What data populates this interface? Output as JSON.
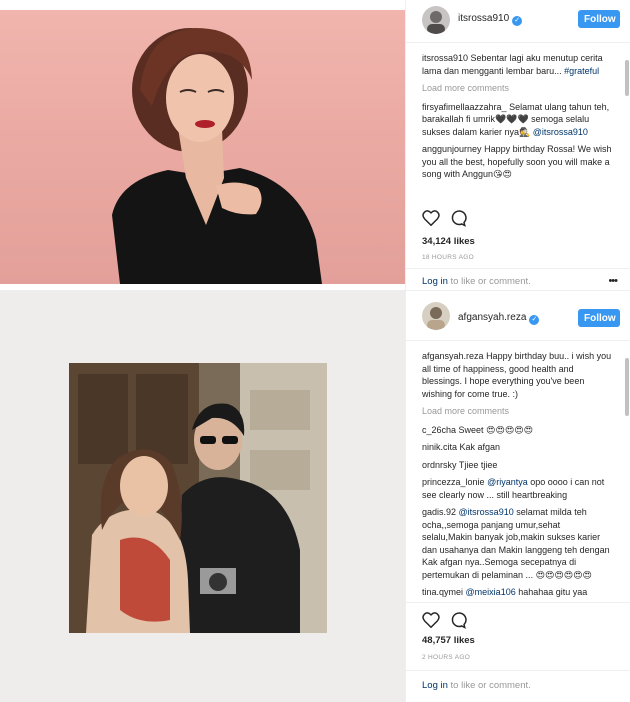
{
  "post1": {
    "username": "itsrossa910",
    "follow_label": "Follow",
    "caption": {
      "user": "itsrossa910",
      "text": "Sebentar lagi aku menutup cerita lama dan mengganti lembar baru...",
      "hashtag": "#grateful"
    },
    "load_more": "Load more comments",
    "comments": [
      {
        "user": "firsyafimellaazzahra_",
        "text": "Selamat ulang tahun teh, barakallah fi umrik🖤🖤🖤 semoga selalu sukses dalam karier nya🕵",
        "mention": "@itsrossa910"
      },
      {
        "user": "anggunjourney",
        "text": "Happy birthday Rossa! We wish you all the best, hopefully soon you will make a song with Anggun😘😍"
      }
    ],
    "likes": "34,124 likes",
    "time": "18 HOURS AGO",
    "login_link": "Log in",
    "login_rest": " to like or comment.",
    "more_options": "•••"
  },
  "post2": {
    "username": "afgansyah.reza",
    "follow_label": "Follow",
    "caption": {
      "user": "afgansyah.reza",
      "text": "Happy birthday buu.. i wish you all time of happiness, good health and blessings. I hope everything you've been wishing for come true. :)"
    },
    "load_more": "Load more comments",
    "comments": [
      {
        "user": "c_26cha",
        "text": "Sweet 😍😍😍😍😍"
      },
      {
        "user": "ninik.cita",
        "text": "Kak afgan"
      },
      {
        "user": "ordnrsky",
        "text": "Tjiee tjiee"
      },
      {
        "user": "princezza_lonie",
        "mention": "@riyantya",
        "text": "opo oooo i can not see clearly now ... still heartbreaking"
      },
      {
        "user": "gadis.92",
        "mention": "@itsrossa910",
        "text": "selamat milda teh ocha,,semoga panjang umur,sehat selalu,Makin banyak job,makin sukses karier dan usahanya dan Makin langgeng teh dengan Kak afgan nya..Semoga secepatnya di pertemukan di pelaminan ... 😍😍😍😍😍😍"
      },
      {
        "user": "tina.qymei",
        "mention": "@meixia106",
        "text": "hahahaa gitu yaa"
      }
    ],
    "likes": "48,757 likes",
    "time": "2 HOURS AGO",
    "login_link": "Log in",
    "login_rest": " to like or comment."
  }
}
